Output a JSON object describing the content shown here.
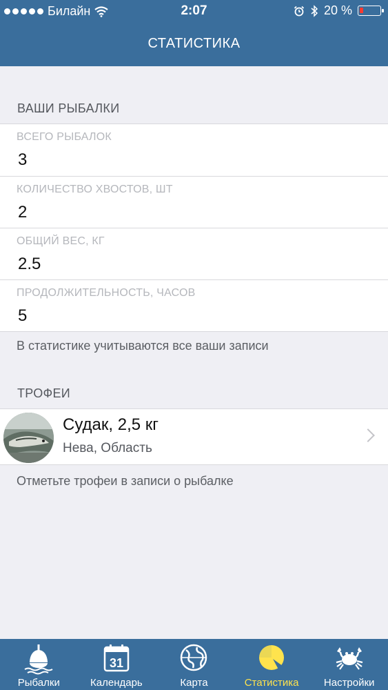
{
  "status_bar": {
    "carrier": "Билайн",
    "time": "2:07",
    "battery_percent": "20 %",
    "battery_level": 0.2
  },
  "header": {
    "title": "СТАТИСТИКА"
  },
  "fishing": {
    "section_title": "ВАШИ РЫБАЛКИ",
    "stats": [
      {
        "label": "ВСЕГО РЫБАЛОК",
        "value": "3"
      },
      {
        "label": "КОЛИЧЕСТВО ХВОСТОВ, ШТ",
        "value": "2"
      },
      {
        "label": "ОБЩИЙ ВЕС, КГ",
        "value": "2.5"
      },
      {
        "label": "ПРОДОЛЖИТЕЛЬНОСТЬ, ЧАСОВ",
        "value": "5"
      }
    ],
    "note": "В статистике учитываются все ваши записи"
  },
  "trophies": {
    "section_title": "ТРОФЕИ",
    "items": [
      {
        "title": "Судак, 2,5 кг",
        "location": "Нева, Область"
      }
    ],
    "note": "Отметьте трофеи в записи о рыбалке"
  },
  "tabbar": {
    "tabs": [
      {
        "label": "Рыбалки",
        "icon": "float-bobber-icon"
      },
      {
        "label": "Календарь",
        "icon": "calendar-icon",
        "icon_text": "31"
      },
      {
        "label": "Карта",
        "icon": "globe-icon"
      },
      {
        "label": "Статистика",
        "icon": "pie-chart-icon",
        "active": true
      },
      {
        "label": "Настройки",
        "icon": "crab-icon"
      }
    ],
    "active_color": "#ffe34d"
  },
  "colors": {
    "header_bg": "#3a6e9c",
    "page_bg": "#efeff4",
    "battery_low": "#ff3b30"
  }
}
